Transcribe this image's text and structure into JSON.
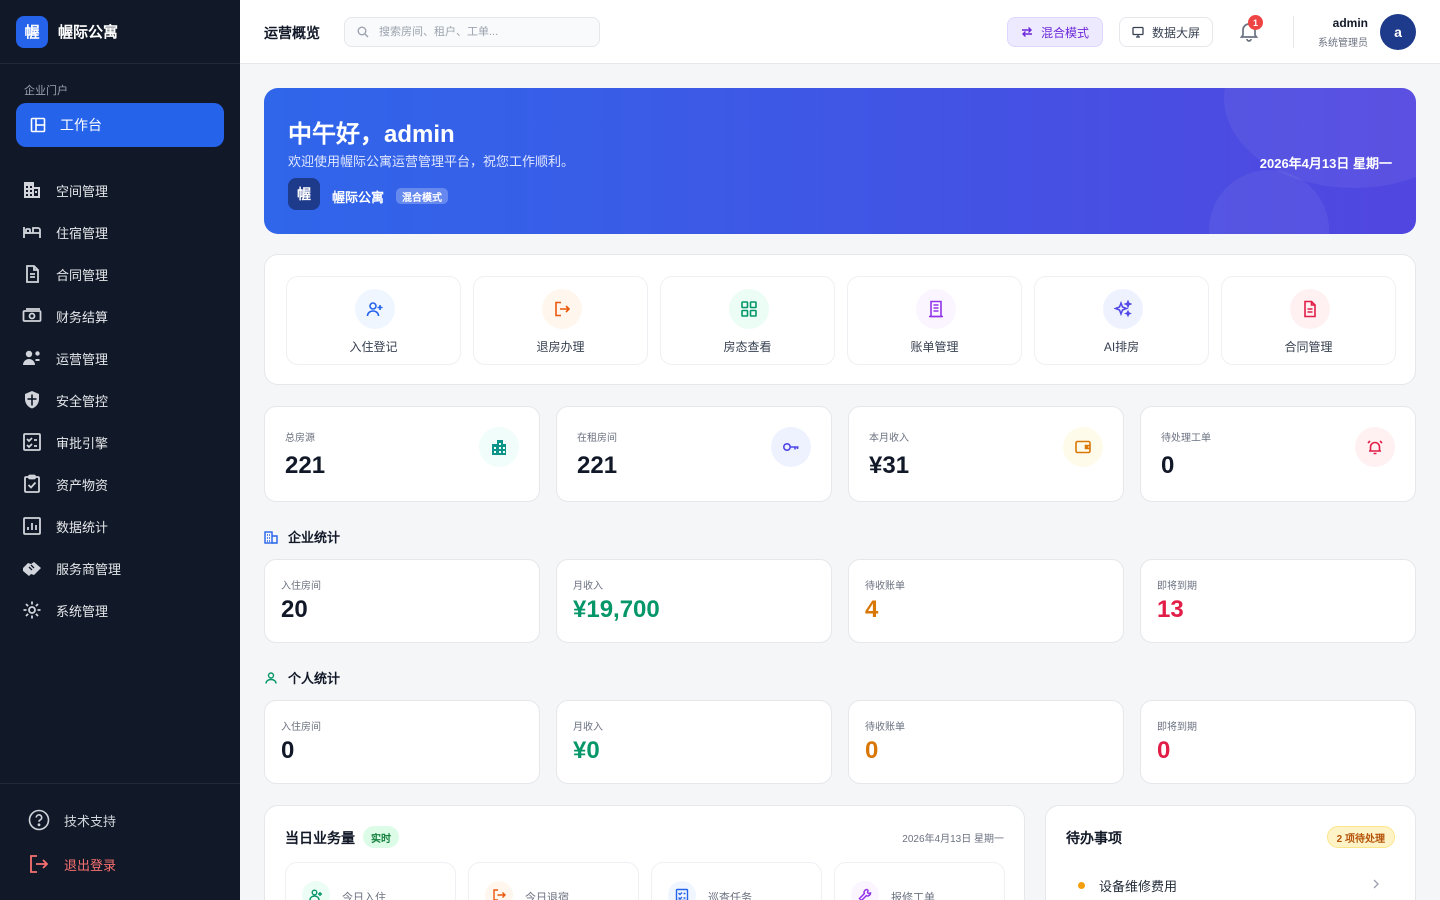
{
  "brand": {
    "logo_char": "幄",
    "name": "幄际公寓"
  },
  "sidebar": {
    "section_label": "企业门户",
    "active_item": "工作台",
    "items": [
      {
        "label": "空间管理",
        "icon": "building-icon"
      },
      {
        "label": "住宿管理",
        "icon": "bed-icon"
      },
      {
        "label": "合同管理",
        "icon": "document-icon"
      },
      {
        "label": "财务结算",
        "icon": "money-icon"
      },
      {
        "label": "运营管理",
        "icon": "users-gear-icon"
      },
      {
        "label": "安全管控",
        "icon": "shield-icon"
      },
      {
        "label": "审批引擎",
        "icon": "checklist-icon"
      },
      {
        "label": "资产物资",
        "icon": "clipboard-icon"
      },
      {
        "label": "数据统计",
        "icon": "chart-icon"
      },
      {
        "label": "服务商管理",
        "icon": "handshake-icon"
      },
      {
        "label": "系统管理",
        "icon": "gear-icon"
      }
    ],
    "support": "技术支持",
    "logout": "退出登录"
  },
  "header": {
    "title": "运营概览",
    "search_placeholder": "搜索房间、租户、工单...",
    "mode_button": "混合模式",
    "screen_button": "数据大屏",
    "notification_count": "1",
    "user_name": "admin",
    "user_role": "系统管理员",
    "avatar_char": "a"
  },
  "banner": {
    "greeting": "中午好，admin",
    "subtitle": "欢迎使用幄际公寓运营管理平台，祝您工作顺利。",
    "logo_char": "幄",
    "brand": "幄际公寓",
    "mode_badge": "混合模式",
    "date": "2026年4月13日 星期一"
  },
  "quick_actions": [
    {
      "label": "入住登记",
      "icon": "user-plus-icon",
      "color": "#2563eb",
      "bg": "#eff6ff"
    },
    {
      "label": "退房办理",
      "icon": "logout-icon",
      "color": "#ea580c",
      "bg": "#fff7ed"
    },
    {
      "label": "房态查看",
      "icon": "grid-icon",
      "color": "#059669",
      "bg": "#ecfdf5"
    },
    {
      "label": "账单管理",
      "icon": "receipt-icon",
      "color": "#9333ea",
      "bg": "#faf5ff"
    },
    {
      "label": "AI排房",
      "icon": "sparkles-icon",
      "color": "#4f46e5",
      "bg": "#eef2ff"
    },
    {
      "label": "合同管理",
      "icon": "file-icon",
      "color": "#e11d48",
      "bg": "#fff1f2"
    }
  ],
  "stats": [
    {
      "label": "总房源",
      "value": "221",
      "icon": "buildings-icon",
      "color": "#0d9488",
      "bg": "#f0fdfa"
    },
    {
      "label": "在租房间",
      "value": "221",
      "icon": "key-icon",
      "color": "#4f46e5",
      "bg": "#eef2ff"
    },
    {
      "label": "本月收入",
      "value": "¥31",
      "icon": "wallet-icon",
      "color": "#d97706",
      "bg": "#fffbeb"
    },
    {
      "label": "待处理工单",
      "value": "0",
      "icon": "alarm-icon",
      "color": "#e11d48",
      "bg": "#fff1f2"
    }
  ],
  "enterprise": {
    "title": "企业统计",
    "cards": [
      {
        "label": "入住房间",
        "value": "20",
        "color": "#111827"
      },
      {
        "label": "月收入",
        "value": "¥19,700",
        "color": "#059669"
      },
      {
        "label": "待收账单",
        "value": "4",
        "color": "#d97706"
      },
      {
        "label": "即将到期",
        "value": "13",
        "color": "#e11d48"
      }
    ]
  },
  "personal": {
    "title": "个人统计",
    "cards": [
      {
        "label": "入住房间",
        "value": "0",
        "color": "#111827"
      },
      {
        "label": "月收入",
        "value": "¥0",
        "color": "#059669"
      },
      {
        "label": "待收账单",
        "value": "0",
        "color": "#d97706"
      },
      {
        "label": "即将到期",
        "value": "0",
        "color": "#e11d48"
      }
    ]
  },
  "daily": {
    "title": "当日业务量",
    "badge": "实时",
    "date": "2026年4月13日 星期一",
    "tiles": [
      {
        "label": "今日入住",
        "icon": "user-plus-icon",
        "color": "#059669",
        "bg": "#ecfdf5"
      },
      {
        "label": "今日退宿",
        "icon": "logout-icon",
        "color": "#ea580c",
        "bg": "#fff7ed"
      },
      {
        "label": "巡查任务",
        "icon": "checklist-icon",
        "color": "#2563eb",
        "bg": "#eff6ff"
      },
      {
        "label": "报修工单",
        "icon": "wrench-icon",
        "color": "#9333ea",
        "bg": "#faf5ff"
      }
    ]
  },
  "todo": {
    "title": "待办事项",
    "badge": "2 项待处理",
    "items": [
      {
        "label": "设备维修费用"
      }
    ]
  }
}
